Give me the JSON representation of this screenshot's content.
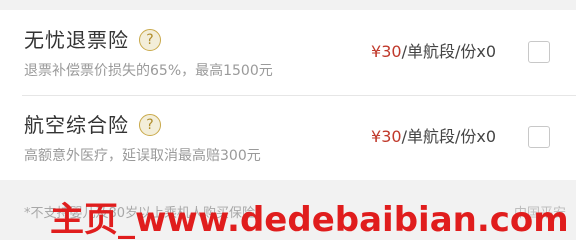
{
  "insurance": [
    {
      "name": "无忧退票险",
      "help": "?",
      "description": "退票补偿票价损失的65%，最高1500元",
      "price_amount": "¥30",
      "price_unit": "/单航段/份x0",
      "checked": false
    },
    {
      "name": "航空综合险",
      "help": "?",
      "description": "高额意外医疗，延误取消最高赔300元",
      "price_amount": "¥30",
      "price_unit": "/单航段/份x0",
      "checked": false
    }
  ],
  "footer": {
    "note": "*不支持婴儿及80岁以上乘机人购买保险",
    "right_text": "中国平安"
  },
  "watermark": "主页_www.dedebaibian.com",
  "colors": {
    "price": "#c0392b",
    "help_icon_border": "#c9a94a",
    "watermark": "#e01d1d"
  }
}
